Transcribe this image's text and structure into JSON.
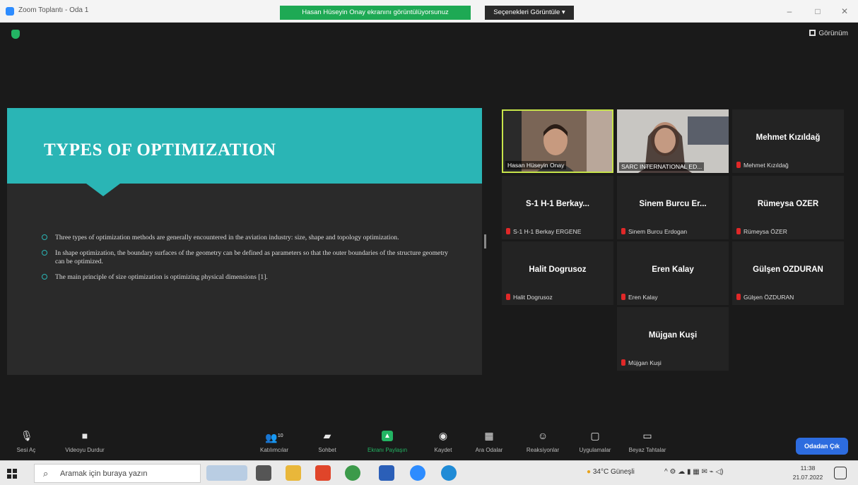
{
  "window": {
    "title": "Zoom Toplantı - Oda 1",
    "speaking_banner": "Hasan Hüseyin Onay ekranını görüntülüyorsunuz",
    "view_select": "Seçenekleri Görüntüle",
    "minimize": "–",
    "maximize": "□",
    "close": "✕"
  },
  "meeting": {
    "view_button": "Görünüm"
  },
  "slide": {
    "title": "TYPES OF OPTIMIZATION",
    "bullets": [
      "Three types of optimization methods are generally encountered in the aviation industry: size, shape and topology optimization.",
      "In shape optimization, the boundary surfaces of the geometry can be defined as parameters so that the outer boundaries of the structure geometry can be optimized.",
      "The main principle of size optimization is optimizing physical dimensions [1]."
    ],
    "accent_color": "#2ab5b5"
  },
  "participants": [
    {
      "label": "Hasan Hüseyin Onay",
      "type": "video",
      "active": true
    },
    {
      "label": "SARC INTERNATIONAL ED...",
      "type": "video",
      "active": false
    },
    {
      "name": "Mehmet Kızıldağ",
      "label": "Mehmet Kızıldağ",
      "type": "name"
    },
    {
      "name": "S-1 H-1 Berkay...",
      "label": "S-1 H-1 Berkay ERGENE",
      "type": "name"
    },
    {
      "name": "Sinem Burcu Er...",
      "label": "Sinem Burcu Erdogan",
      "type": "name"
    },
    {
      "name": "Rümeysa ÖZER",
      "label": "Rümeysa ÖZER",
      "type": "name"
    },
    {
      "name": "Halit Dogrusoz",
      "label": "Halit Dogrusoz",
      "type": "name"
    },
    {
      "name": "Eren Kalay",
      "label": "Eren Kalay",
      "type": "name"
    },
    {
      "name": "Gülşen ÖZDURAN",
      "label": "Gülşen ÖZDURAN",
      "type": "name"
    },
    {
      "name": "Müjgan Kuşi",
      "label": "Müjgan Kuşi",
      "type": "name"
    }
  ],
  "toolbar": {
    "audio": "Sesi Aç",
    "video": "Videoyu Durdur",
    "participants": "Katılımcılar",
    "participants_count": "10",
    "chat": "Sohbet",
    "share": "Ekranı Paylaşın",
    "record": "Kaydet",
    "breakout": "Ara Odalar",
    "reactions": "Reaksiyonlar",
    "apps": "Uygulamalar",
    "whiteboard": "Beyaz Tahtalar",
    "leave": "Odadan Çık"
  },
  "taskbar": {
    "search_placeholder": "Aramak için buraya yazın",
    "weather": "34°C Güneşli",
    "time": "11:38",
    "date": "21.07.2022"
  }
}
